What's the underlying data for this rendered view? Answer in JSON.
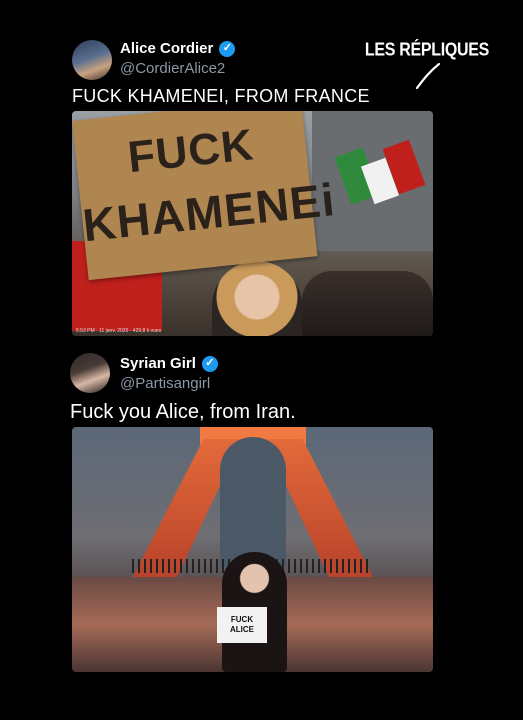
{
  "brand": {
    "name": "LES RÉPLIQUES"
  },
  "posts": [
    {
      "author": "Alice Cordier",
      "handle": "@CordierAlice2",
      "text": "FUCK KHAMENEI, FROM FRANCE",
      "photo": {
        "sign_line_1": "FUCK",
        "sign_line_2": "KHAMENEi",
        "caption": "5:53 PM · 11 janv. 2026 · 429,8 k vues"
      }
    },
    {
      "author": "Syrian Girl",
      "handle": "@Partisangirl",
      "text": "Fuck you Alice, from Iran.",
      "photo": {
        "sign_line_1": "FUCK",
        "sign_line_2": "ALICE"
      }
    }
  ],
  "colors": {
    "verified": "#1d9bf0",
    "handle": "#8b98a5",
    "background": "#000000"
  }
}
